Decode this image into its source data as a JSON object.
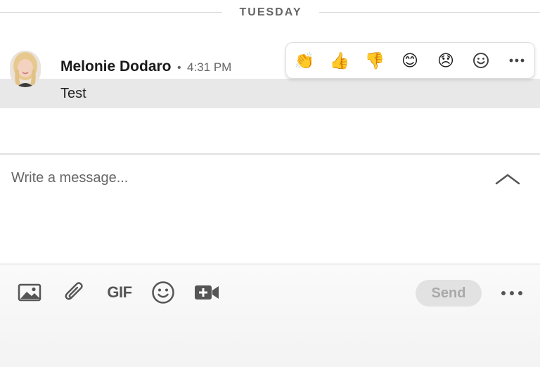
{
  "day_divider": {
    "label": "TUESDAY"
  },
  "message": {
    "sender_name": "Melonie Dodaro",
    "separator": "•",
    "time": "4:31 PM",
    "text": "Test"
  },
  "reactions": [
    {
      "name": "clap-reaction",
      "glyph": "👏"
    },
    {
      "name": "thumbs-up-reaction",
      "glyph": "👍"
    },
    {
      "name": "thumbs-down-reaction",
      "glyph": "👎"
    },
    {
      "name": "smile-reaction",
      "glyph": "😊"
    },
    {
      "name": "sad-reaction",
      "glyph": "😞"
    }
  ],
  "reaction_bar": {
    "add_reaction_icon": "smiley-outline-icon",
    "more_icon": "ellipsis-icon"
  },
  "compose": {
    "placeholder": "Write a message..."
  },
  "toolbar": {
    "image_icon": "image-icon",
    "attach_icon": "paperclip-icon",
    "gif_label": "GIF",
    "emoji_icon": "emoji-icon",
    "video_icon": "video-meeting-icon",
    "send_label": "Send",
    "more_icon": "ellipsis-icon"
  },
  "colors": {
    "send_disabled_bg": "#e2e2e2",
    "send_disabled_text": "#a9a9a9",
    "icon_gray": "#555555"
  }
}
